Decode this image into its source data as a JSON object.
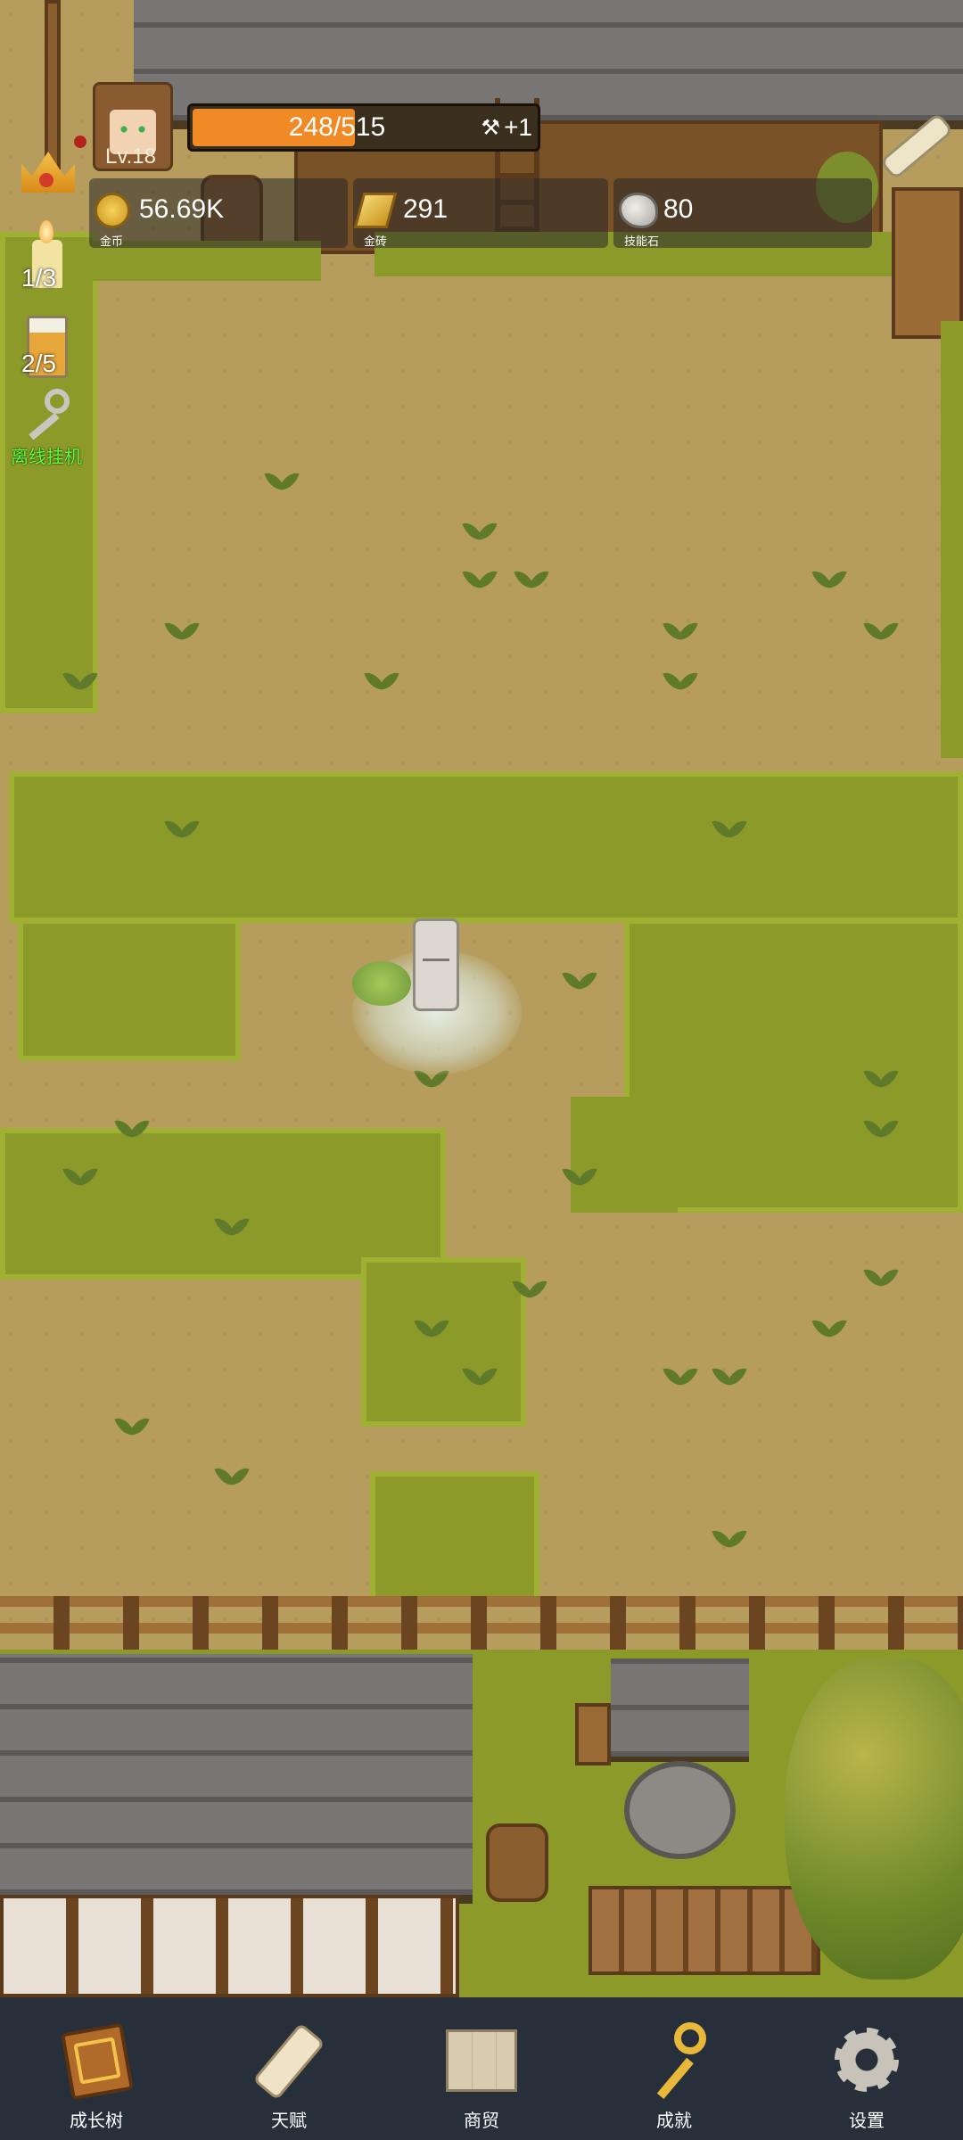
{
  "player": {
    "level": "Lv.18",
    "exp_current": 248,
    "exp_max": 515,
    "exp_text": "248/515",
    "plus_text": "+1"
  },
  "resources": [
    {
      "icon": "gold-coin-icon",
      "value": "56.69K",
      "label": "金币"
    },
    {
      "icon": "gold-brick-icon",
      "value": "291",
      "label": "金砖"
    },
    {
      "icon": "skill-stone-icon",
      "value": "80",
      "label": "技能石"
    }
  ],
  "side_counters": {
    "candle": "1/3",
    "beer": "2/5",
    "idle_label": "离线挂机"
  },
  "nav": [
    {
      "icon": "book-icon",
      "label": "成长树"
    },
    {
      "icon": "scroll-icon",
      "label": "天赋"
    },
    {
      "icon": "map-icon",
      "label": "商贸"
    },
    {
      "icon": "key-icon",
      "label": "成就"
    },
    {
      "icon": "gear-icon",
      "label": "设置"
    }
  ],
  "colors": {
    "exp_bar": "#f08a25",
    "grass": "#8c9a2a",
    "dirt": "#b69d5e",
    "nav_bg": "#262f3a",
    "idle_label": "#5cff3a"
  }
}
